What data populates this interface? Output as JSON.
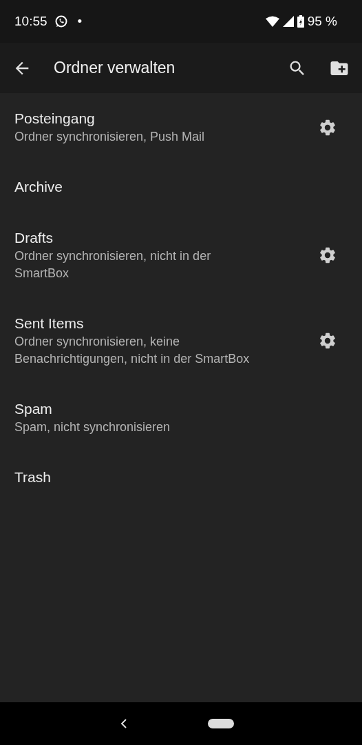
{
  "status_bar": {
    "time": "10:55",
    "dot": "•",
    "battery": "95 %"
  },
  "app_bar": {
    "title": "Ordner verwalten"
  },
  "folders": [
    {
      "name": "Posteingang",
      "details": "Ordner synchronisieren, Push Mail",
      "has_settings": true
    },
    {
      "name": "Archive",
      "has_settings": false
    },
    {
      "name": "Drafts",
      "details": "Ordner synchronisieren, nicht in der SmartBox",
      "has_settings": true
    },
    {
      "name": "Sent Items",
      "details": "Ordner synchronisieren, keine Benachrichtigungen, nicht in der SmartBox",
      "has_settings": true
    },
    {
      "name": "Spam",
      "details": "Spam, nicht synchronisieren",
      "has_settings": false
    },
    {
      "name": "Trash",
      "has_settings": false
    }
  ]
}
